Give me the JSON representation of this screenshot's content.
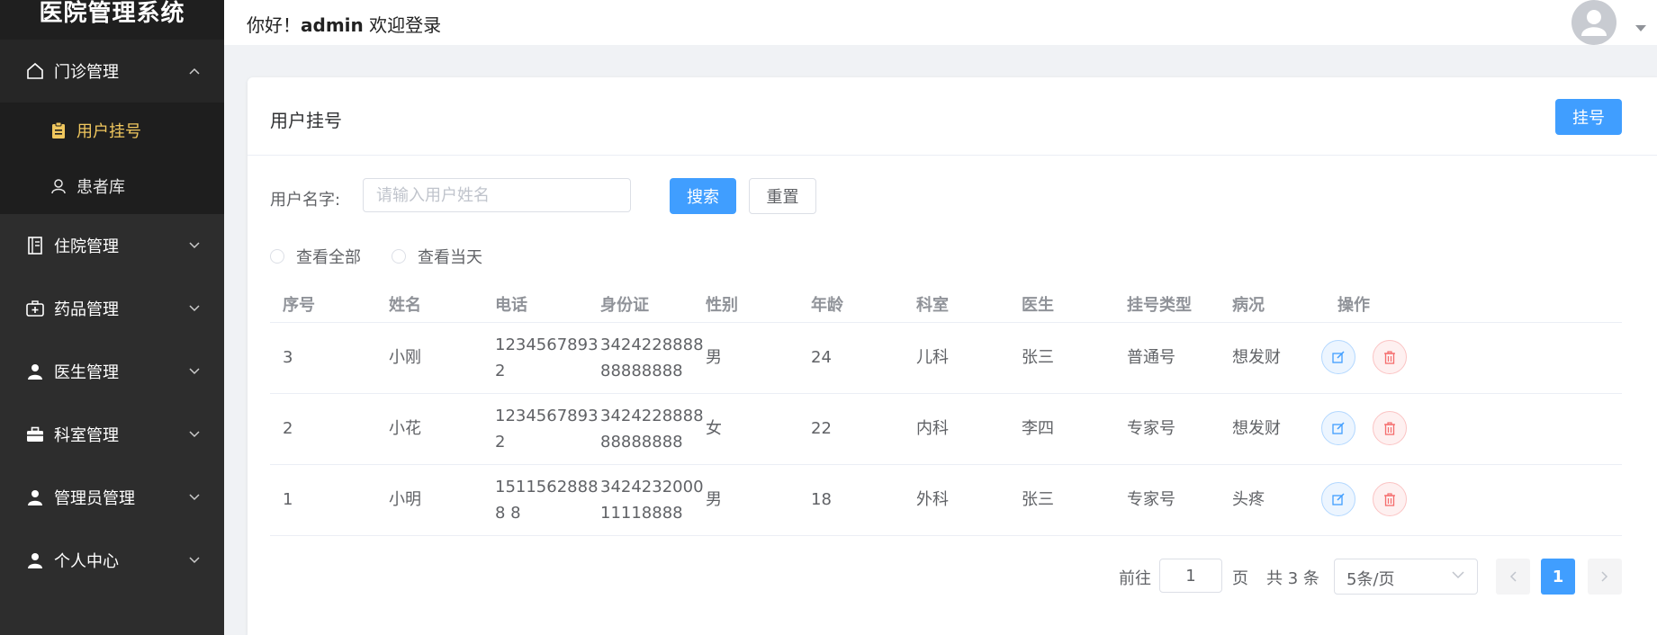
{
  "app": {
    "title": "医院管理系统"
  },
  "header": {
    "greeting_prefix": "你好！",
    "username": "admin",
    "greeting_suffix": " 欢迎登录"
  },
  "sidebar": {
    "menus": [
      {
        "label": "门诊管理",
        "icon": "home-icon",
        "open": true,
        "children": [
          {
            "label": "用户挂号",
            "icon": "clipboard-icon",
            "active": true
          },
          {
            "label": "患者库",
            "icon": "user-outline-icon"
          }
        ]
      },
      {
        "label": "住院管理",
        "icon": "document-icon"
      },
      {
        "label": "药品管理",
        "icon": "medkit-icon"
      },
      {
        "label": "医生管理",
        "icon": "doctor-icon"
      },
      {
        "label": "科室管理",
        "icon": "briefcase-icon"
      },
      {
        "label": "管理员管理",
        "icon": "user-icon"
      },
      {
        "label": "个人中心",
        "icon": "user-icon"
      }
    ]
  },
  "card": {
    "title": "用户挂号",
    "register_button": "挂号"
  },
  "search": {
    "label": "用户名字:",
    "placeholder": "请输入用户姓名",
    "value": "",
    "search_button": "搜索",
    "reset_button": "重置"
  },
  "filters": {
    "all_label": "查看全部",
    "today_label": "查看当天"
  },
  "table": {
    "columns": [
      "序号",
      "姓名",
      "电话",
      "身份证",
      "性别",
      "年龄",
      "科室",
      "医生",
      "挂号类型",
      "病况",
      "操作"
    ],
    "rows": [
      {
        "id": "3",
        "name": "小刚",
        "phone": "12345678932",
        "id_card": "342422888888888888",
        "gender": "男",
        "age": "24",
        "dept": "儿科",
        "doctor": "张三",
        "type": "普通号",
        "condition": "想发财"
      },
      {
        "id": "2",
        "name": "小花",
        "phone": "12345678932",
        "id_card": "342422888888888888",
        "gender": "女",
        "age": "22",
        "dept": "内科",
        "doctor": "李四",
        "type": "专家号",
        "condition": "想发财"
      },
      {
        "id": "1",
        "name": "小明",
        "phone": "15115628888 8",
        "id_card": "342423200011118888",
        "gender": "男",
        "age": "18",
        "dept": "外科",
        "doctor": "张三",
        "type": "专家号",
        "condition": "头疼"
      }
    ]
  },
  "pagination": {
    "goto_label": "前往",
    "goto_value": "1",
    "page_unit": "页",
    "total_text": "共 3 条",
    "page_size": "5条/页",
    "current_page": "1"
  },
  "colors": {
    "primary": "#409eff",
    "sidebar_bg": "#2d2d2d",
    "active_menu": "#f0c75e",
    "danger": "#f56c6c"
  }
}
